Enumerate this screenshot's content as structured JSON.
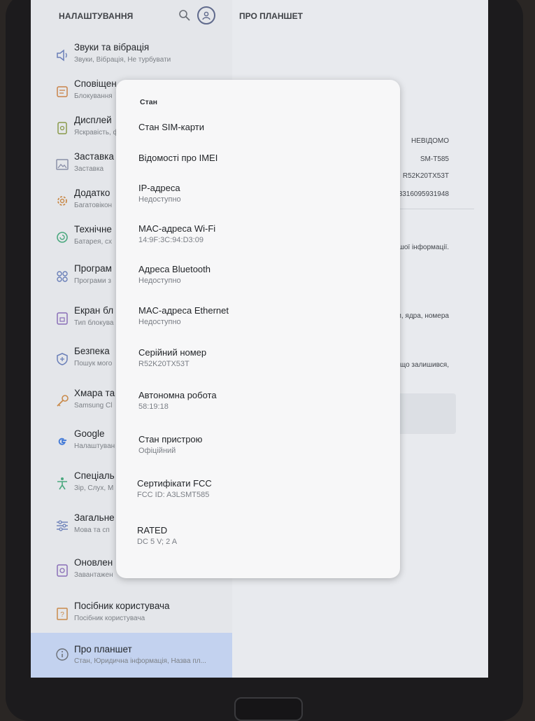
{
  "left_panel": {
    "title": "НАЛАШТУВАННЯ",
    "items": [
      {
        "title": "Звуки та вібрація",
        "subtitle": "Звуки, Вібрація, Не турбувати",
        "icon": "speaker-icon"
      },
      {
        "title": "Сповіщен",
        "subtitle": "Блокування",
        "icon": "notification-icon"
      },
      {
        "title": "Дисплей",
        "subtitle": "Яскравість, ф",
        "icon": "display-icon"
      },
      {
        "title": "Заставка",
        "subtitle": "Заставка",
        "icon": "wallpaper-icon"
      },
      {
        "title": "Додатко",
        "subtitle": "Багатовікон",
        "icon": "gear-plus-icon"
      },
      {
        "title": "Технічне",
        "subtitle": "Батарея, сх",
        "icon": "device-care-icon"
      },
      {
        "title": "Програм",
        "subtitle": "Програми з",
        "icon": "apps-icon"
      },
      {
        "title": "Екран бл",
        "subtitle": "Тип блокува",
        "icon": "lock-icon"
      },
      {
        "title": "Безпека",
        "subtitle": "Пошук мого",
        "icon": "shield-icon"
      },
      {
        "title": "Хмара та",
        "subtitle": "Samsung Cl",
        "icon": "key-icon"
      },
      {
        "title": "Google",
        "subtitle": "Налаштуван",
        "icon": "google-icon"
      },
      {
        "title": "Спеціаль",
        "subtitle": "Зір, Слух, М",
        "icon": "accessibility-icon"
      },
      {
        "title": "Загальне",
        "subtitle": "Мова та сп",
        "icon": "sliders-icon"
      },
      {
        "title": "Оновлен",
        "subtitle": "Завантажен",
        "icon": "update-icon"
      },
      {
        "title": "Посібник користувача",
        "subtitle": "Посібник користувача",
        "icon": "help-icon"
      },
      {
        "title": "Про планшет",
        "subtitle": "Стан, Юридична інформація, Назва пл...",
        "icon": "info-icon"
      }
    ]
  },
  "right_panel": {
    "title": "ПРО ПЛАНШЕТ",
    "values": [
      "НЕВІДОМО",
      "SM-T585",
      "R52K20TX53T",
      "3316095931948"
    ],
    "notes": [
      "і іншої інформації.",
      "готи, ядра, номера",
      "ряду, що залишився,"
    ]
  },
  "dialog": {
    "title": "Стан",
    "items": [
      {
        "title": "Стан SIM-карти",
        "subtitle": ""
      },
      {
        "title": "Відомості про IMEI",
        "subtitle": ""
      },
      {
        "title": "IP-адреса",
        "subtitle": "Недоступно"
      },
      {
        "title": "MAC-адреса Wi-Fi",
        "subtitle": "14:9F:3C:94:D3:09"
      },
      {
        "title": "Адреса Bluetooth",
        "subtitle": "Недоступно"
      },
      {
        "title": "MAC-адреса Ethernet",
        "subtitle": "Недоступно"
      },
      {
        "title": "Серійний номер",
        "subtitle": "R52K20TX53T"
      },
      {
        "title": "Автономна робота",
        "subtitle": "58:19:18"
      },
      {
        "title": "Стан пристрою",
        "subtitle": "Офіційний"
      },
      {
        "title": "Сертифікати FCC",
        "subtitle": "FCC ID: A3LSMT585"
      },
      {
        "title": "RATED",
        "subtitle": "DC 5 V; 2 A"
      }
    ]
  }
}
